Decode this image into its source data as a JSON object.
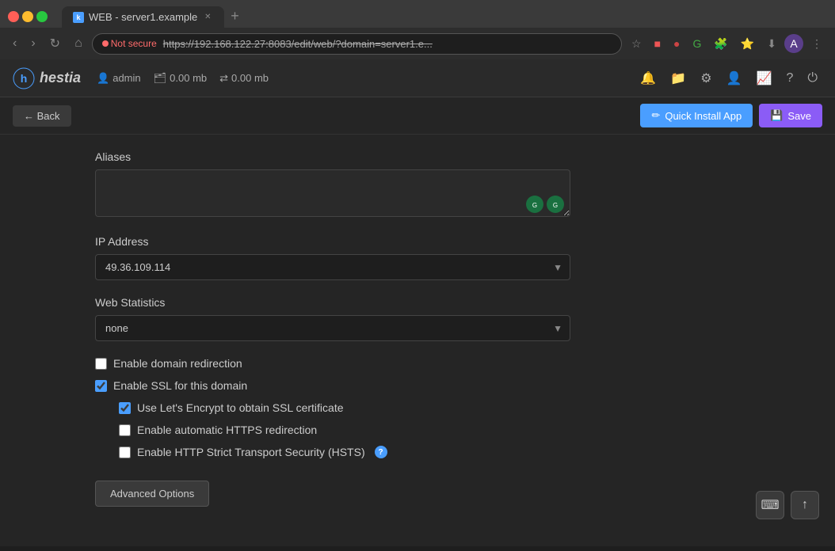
{
  "browser": {
    "tab_title": "WEB - server1.example",
    "tab_favicon": "k",
    "not_secure_text": "Not secure",
    "url": "https://192.168.122.27:8083/edit/web/?domain=server1.e...",
    "nav_back": "‹",
    "nav_forward": "›",
    "nav_refresh": "↻",
    "nav_home": "⌂"
  },
  "header": {
    "logo_text": "hestia",
    "logo_icon": "h",
    "admin_label": "admin",
    "ram_label1": "0.00 mb",
    "ram_label2": "0.00 mb"
  },
  "actions": {
    "back_label": "← Back",
    "quick_install_label": "Quick Install App",
    "save_label": "Save"
  },
  "form": {
    "aliases_label": "Aliases",
    "aliases_value": "",
    "aliases_placeholder": "",
    "ip_address_label": "IP Address",
    "ip_address_value": "49.36.109.114",
    "ip_address_options": [
      "49.36.109.114"
    ],
    "web_stats_label": "Web Statistics",
    "web_stats_value": "none",
    "web_stats_options": [
      "none"
    ],
    "checkbox_domain_redirect_label": "Enable domain redirection",
    "checkbox_domain_redirect_checked": false,
    "checkbox_ssl_label": "Enable SSL for this domain",
    "checkbox_ssl_checked": true,
    "checkbox_letsencrypt_label": "Use Let's Encrypt to obtain SSL certificate",
    "checkbox_letsencrypt_checked": true,
    "checkbox_https_redirect_label": "Enable automatic HTTPS redirection",
    "checkbox_https_redirect_checked": false,
    "checkbox_hsts_label": "Enable HTTP Strict Transport Security (HSTS)",
    "checkbox_hsts_checked": false,
    "advanced_btn_label": "Advanced Options"
  },
  "scroll": {
    "keyboard_icon": "⌨",
    "up_icon": "↑"
  }
}
